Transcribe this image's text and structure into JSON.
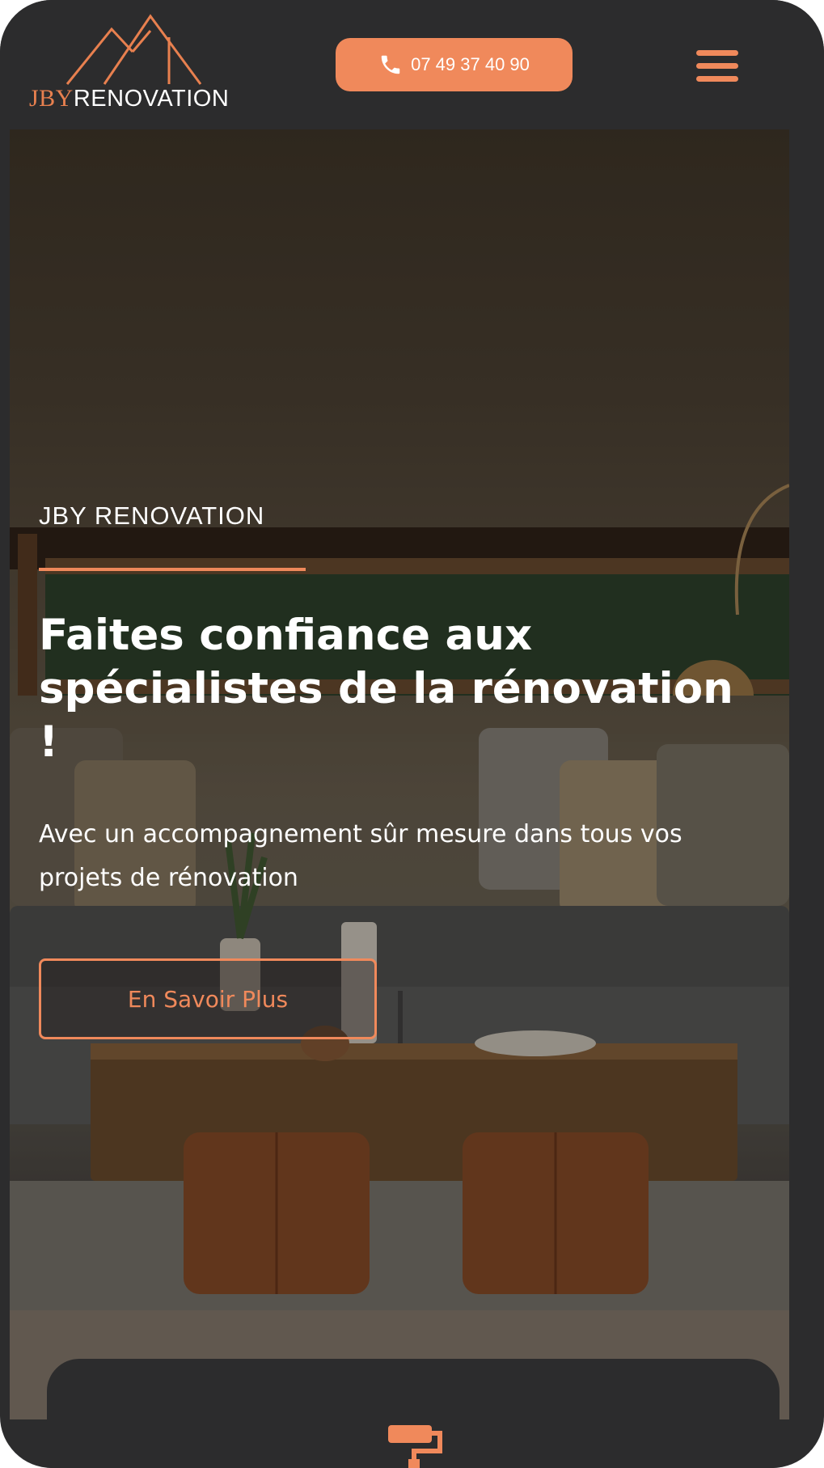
{
  "header": {
    "logo": {
      "brand_part1": "JBY",
      "brand_part2": "RENOVATION"
    },
    "phone_button": {
      "label": "07 49 37 40 90",
      "icon": "phone-icon"
    },
    "menu": {
      "icon": "hamburger-menu-icon"
    }
  },
  "hero": {
    "eyebrow": "JBY RENOVATION",
    "headline": "Faites confiance aux spécialistes de la rénovation !",
    "subtitle": "Avec un accompagnement sûr mesure dans tous vos projets de rénovation",
    "cta_label": "En Savoir Plus"
  },
  "services_card": {
    "icon": "paint-roller-icon"
  },
  "colors": {
    "accent": "#f0895b",
    "background": "#2c2c2d",
    "text": "#ffffff"
  }
}
